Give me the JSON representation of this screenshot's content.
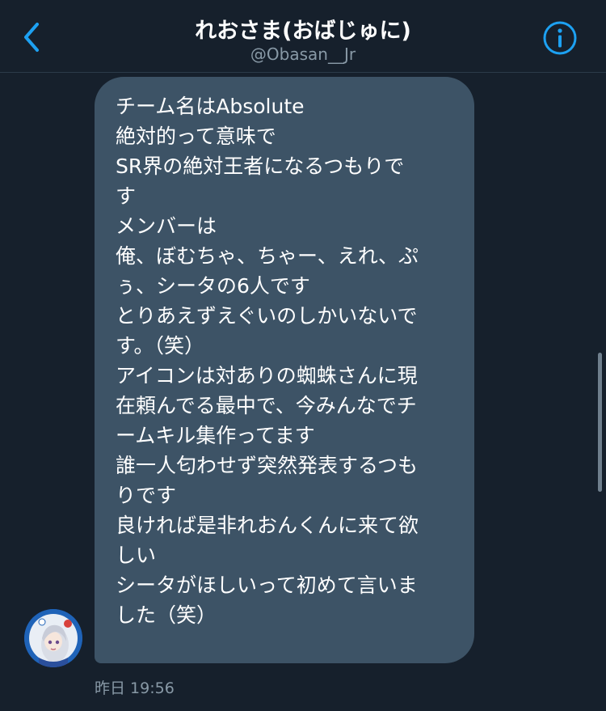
{
  "header": {
    "title": "れおさま(おばじゅに)",
    "handle": "@Obasan__Jr",
    "back_icon": "chevron-left-icon",
    "info_icon": "info-circle-icon",
    "accent_color": "#1da1f2"
  },
  "message": {
    "text": "チーム名はAbsolute\n絶対的って意味で\nSR界の絶対王者になるつもりで\nす\nメンバーは\n俺、ぼむちゃ、ちゃー、えれ、ぷ\nぅ、シータの6人です\nとりあえずえぐいのしかいないで\nす。（笑）\nアイコンは対ありの蜘蛛さんに現\n在頼んでる最中で、今みんなでチ\nームキル集作ってます\n誰一人匂わせず突然発表するつも\nりです\n良ければ是非れおんくんに来て欲\nしい\nシータがほしいって初めて言いま\nした（笑）",
    "timestamp": "昨日 19:56",
    "bubble_color": "#3d5366",
    "avatar_icon": "user-avatar"
  },
  "theme": {
    "background": "#16202c",
    "secondary_text": "#8899a6"
  }
}
